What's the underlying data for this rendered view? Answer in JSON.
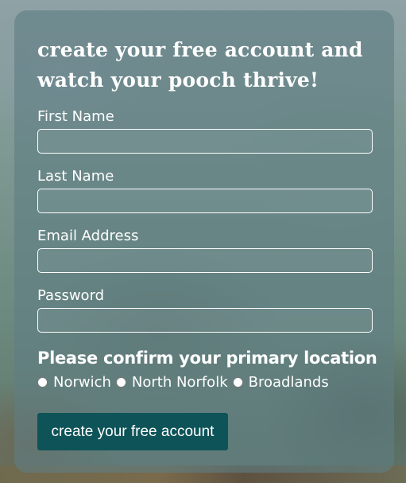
{
  "form": {
    "heading": "create your free account and watch your pooch thrive!",
    "fields": [
      {
        "label": "First Name",
        "value": ""
      },
      {
        "label": "Last Name",
        "value": ""
      },
      {
        "label": "Email Address",
        "value": ""
      },
      {
        "label": "Password",
        "value": ""
      }
    ],
    "location": {
      "title": "Please confirm your primary location",
      "options": [
        "Norwich",
        "North Norfolk",
        "Broadlands"
      ]
    },
    "submit_label": "create your free account"
  },
  "colors": {
    "button_bg": "#0d5358",
    "text": "#ffffff",
    "card_overlay": "rgba(96,126,130,0.62)"
  }
}
